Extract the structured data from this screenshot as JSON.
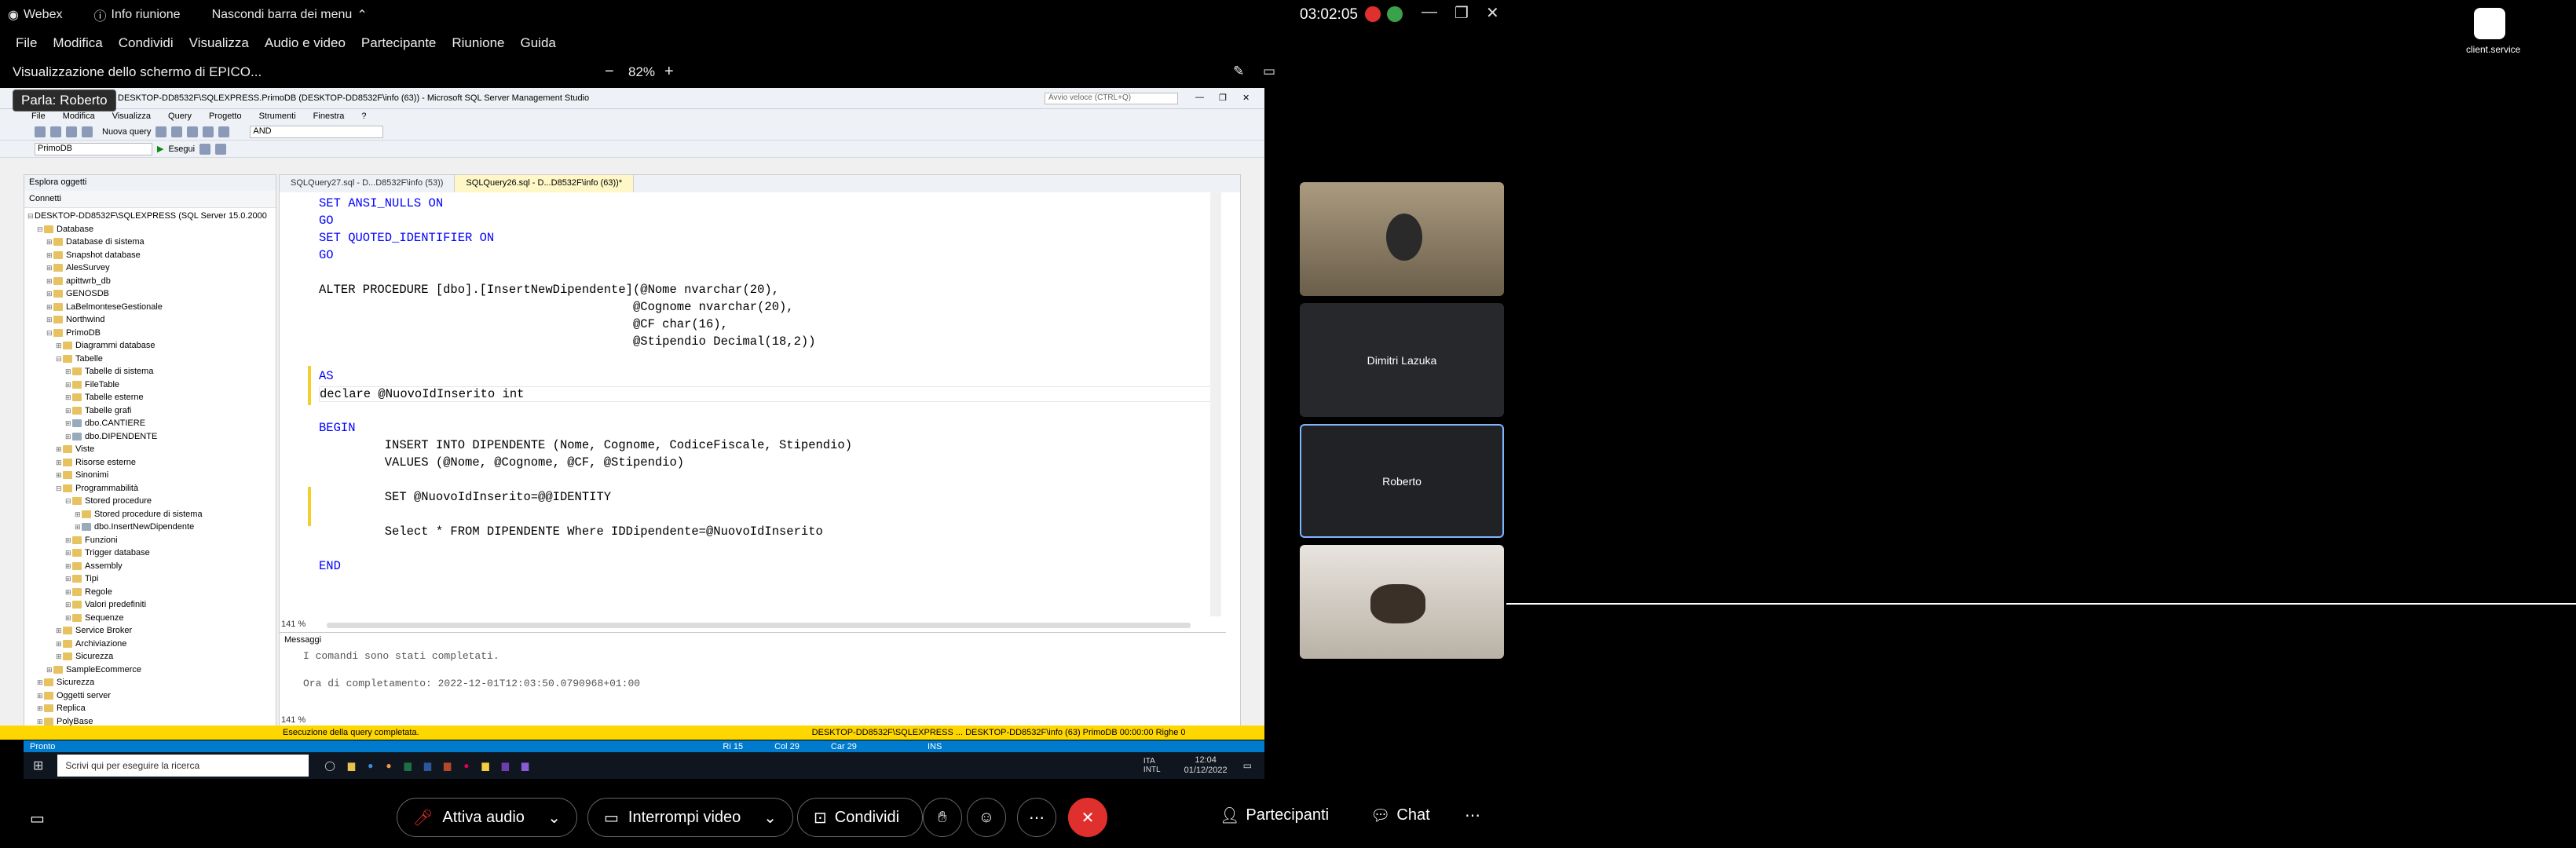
{
  "titlebar": {
    "app_name": "Webex",
    "info": "Info riunione",
    "hide_menu": "Nascondi barra dei menu",
    "clock": "03:02:05"
  },
  "menu": [
    "File",
    "Modifica",
    "Condividi",
    "Visualizza",
    "Audio e video",
    "Partecipante",
    "Riunione",
    "Guida"
  ],
  "share": {
    "title": "Visualizzazione dello schermo di EPICO...",
    "zoom": "82%",
    "speaker": "Parla: Roberto"
  },
  "ssms": {
    "window_title": "DESKTOP-DD8532F\\SQLEXPRESS.PrimoDB (DESKTOP-DD8532F\\info (63)) - Microsoft SQL Server Management Studio",
    "search_placeholder": "Avvio veloce (CTRL+Q)",
    "menu": [
      "File",
      "Modifica",
      "Visualizza",
      "Query",
      "Progetto",
      "Strumenti",
      "Finestra",
      "?"
    ],
    "toolbar_new_query": "Nuova query",
    "db_select": "PrimoDB",
    "execute": "Esegui",
    "and_combo": "AND",
    "explorer_title": "Esplora oggetti",
    "connect": "Connetti",
    "tree": [
      "DESKTOP-DD8532F\\SQLEXPRESS (SQL Server 15.0.2000",
      "Database",
      "Database di sistema",
      "Snapshot database",
      "AlesSurvey",
      "apittwrb_db",
      "GENOSDB",
      "LaBelmonteseGestionale",
      "Northwind",
      "PrimoDB",
      "Diagrammi database",
      "Tabelle",
      "Tabelle di sistema",
      "FileTable",
      "Tabelle esterne",
      "Tabelle grafi",
      "dbo.CANTIERE",
      "dbo.DIPENDENTE",
      "Viste",
      "Risorse esterne",
      "Sinonimi",
      "Programmabilità",
      "Stored procedure",
      "Stored procedure di sistema",
      "dbo.InsertNewDipendente",
      "Funzioni",
      "Trigger database",
      "Assembly",
      "Tipi",
      "Regole",
      "Valori predefiniti",
      "Sequenze",
      "Service Broker",
      "Archiviazione",
      "Sicurezza",
      "SampleEcommerce",
      "Sicurezza",
      "Oggetti server",
      "Replica",
      "PolyBase"
    ],
    "tabs": [
      "SQLQuery27.sql - D...D8532F\\info (53))",
      "SQLQuery26.sql - D...D8532F\\info (63))*"
    ],
    "code": [
      "SET ANSI_NULLS ON",
      "GO",
      "SET QUOTED_IDENTIFIER ON",
      "GO",
      "",
      "ALTER PROCEDURE [dbo].[InsertNewDipendente](@Nome nvarchar(20),",
      "                                           @Cognome nvarchar(20),",
      "                                           @CF char(16),",
      "                                           @Stipendio Decimal(18,2))",
      "",
      "AS",
      "declare @NuovoIdInserito int",
      "",
      "BEGIN",
      "         INSERT INTO DIPENDENTE (Nome, Cognome, CodiceFiscale, Stipendio)",
      "         VALUES (@Nome, @Cognome, @CF, @Stipendio)",
      "",
      "         SET @NuovoIdInserito=@@IDENTITY",
      "",
      "         Select * FROM DIPENDENTE Where IDDipendente=@NuovoIdInserito",
      "",
      "END"
    ],
    "zoom": "141 %",
    "messages_tab": "Messaggi",
    "messages": [
      "I comandi sono stati completati.",
      "",
      "Ora di completamento: 2022-12-01T12:03:50.0790968+01:00"
    ],
    "status_left": "Esecuzione della query completata.",
    "status_right": "DESKTOP-DD8532F\\SQLEXPRESS ...   DESKTOP-DD8532F\\info (63)   PrimoDB   00:00:00   Righe 0",
    "ready": "Pronto",
    "pos": [
      "Ri 15",
      "Col 29",
      "Car 29",
      "INS"
    ],
    "taskbar_search": "Scrivi qui per eseguire la ricerca",
    "taskbar_time": "12:04",
    "taskbar_date": "01/12/2022",
    "taskbar_lang": "ITA\nINTL"
  },
  "right": {
    "client_label": "client.service",
    "participants": [
      "",
      "Dimitri Lazuka",
      "Roberto",
      ""
    ]
  },
  "controls": {
    "mute": "Attiva audio",
    "video": "Interrompi video",
    "share": "Condividi",
    "participants": "Partecipanti",
    "chat": "Chat"
  },
  "colors": {
    "end_call": "#e0302e",
    "accent": "#7fb4ff"
  }
}
